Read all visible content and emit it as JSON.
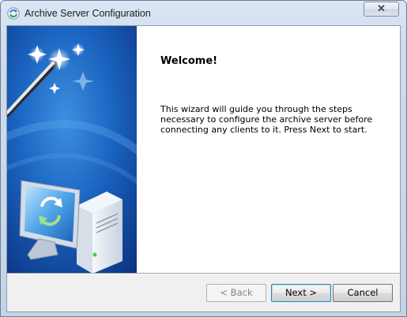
{
  "window": {
    "title": "Archive Server Configuration",
    "close_label": "✕"
  },
  "wizard": {
    "heading": "Welcome!",
    "description": "This wizard will guide you through the steps necessary to configure the archive server before connecting any clients to it. Press Next to start."
  },
  "buttons": {
    "back": "< Back",
    "next": "Next >",
    "cancel": "Cancel",
    "back_enabled": false
  },
  "icons": {
    "title": "refresh-app-icon",
    "banner": "magic-wand-computer-illustration"
  },
  "colors": {
    "banner_blue": "#1f6cc4",
    "banner_dark": "#0b3f8f"
  }
}
